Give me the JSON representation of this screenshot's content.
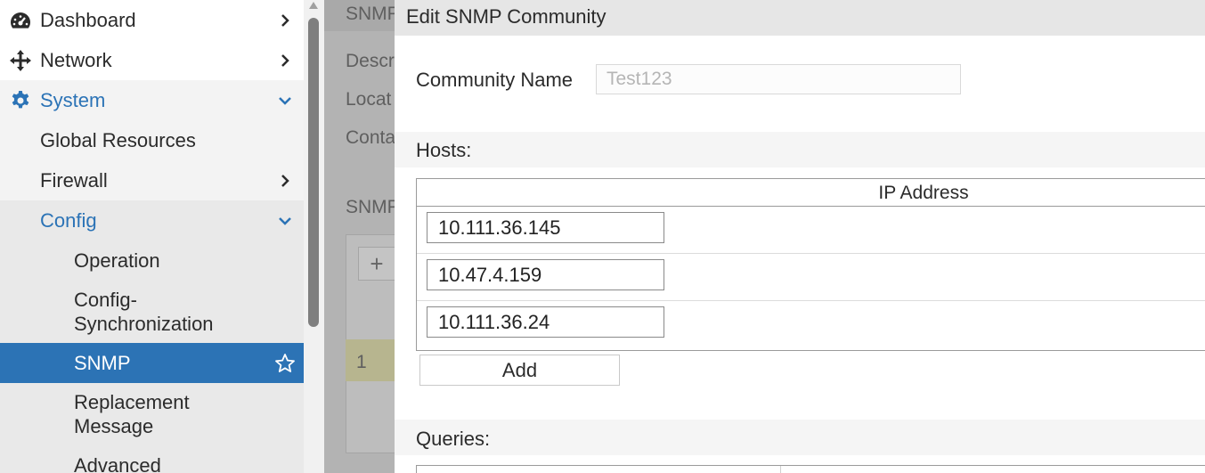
{
  "sidebar": {
    "items": [
      {
        "label": "Dashboard",
        "icon": "dashboard-icon",
        "chevron": "right"
      },
      {
        "label": "Network",
        "icon": "move-arrows-icon",
        "chevron": "right"
      },
      {
        "label": "System",
        "icon": "gear-icon",
        "chevron": "down"
      },
      {
        "label": "Global Resources"
      },
      {
        "label": "Firewall",
        "chevron": "right"
      },
      {
        "label": "Config",
        "chevron": "down"
      },
      {
        "label": "Operation"
      },
      {
        "label": "Config-",
        "label2": "Synchronization"
      },
      {
        "label": "SNMP",
        "icon": "star-icon"
      },
      {
        "label": "Replacement",
        "label2": "Message"
      },
      {
        "label": "Advanced"
      }
    ],
    "accent": "#2c73b5"
  },
  "background": {
    "header": "SNMP",
    "desc": "Descr",
    "loc": "Locat",
    "contact": "Conta",
    "section": "SNMP",
    "row_index": "1",
    "plus": "+"
  },
  "dialog": {
    "title": "Edit SNMP Community",
    "community_name_label": "Community Name",
    "community_name_placeholder": "Test123",
    "hosts_label": "Hosts:",
    "ip_header": "IP Address",
    "hosts": [
      "10.111.36.145",
      "10.47.4.159",
      "10.111.36.24"
    ],
    "add_label": "Add",
    "queries_label": "Queries:"
  }
}
